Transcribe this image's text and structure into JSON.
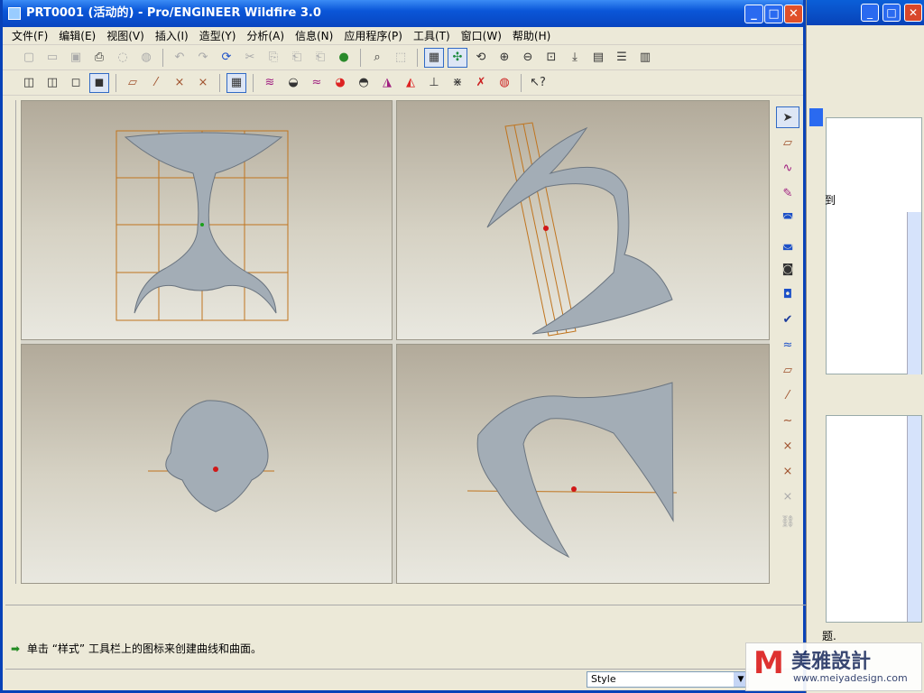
{
  "window": {
    "title": "PRT0001 (活动的) - Pro/ENGINEER Wildfire 3.0",
    "min": "_",
    "max": "□",
    "close": "✕"
  },
  "menu": [
    "文件(F)",
    "编辑(E)",
    "视图(V)",
    "插入(I)",
    "造型(Y)",
    "分析(A)",
    "信息(N)",
    "应用程序(P)",
    "工具(T)",
    "窗口(W)",
    "帮助(H)"
  ],
  "background_window": {
    "side_text_1": "到",
    "side_text_2": "题."
  },
  "status": {
    "message": "单击 “样式” 工具栏上的图标来创建曲线和曲面。"
  },
  "style_combo": {
    "value": "Style"
  },
  "watermark": {
    "cn": "美雅設計",
    "url": "www.meiyadesign.com"
  },
  "colors": {
    "titlebar": "#0a56d8",
    "grid": "#c0741e",
    "surface": "#9aa4ae"
  }
}
